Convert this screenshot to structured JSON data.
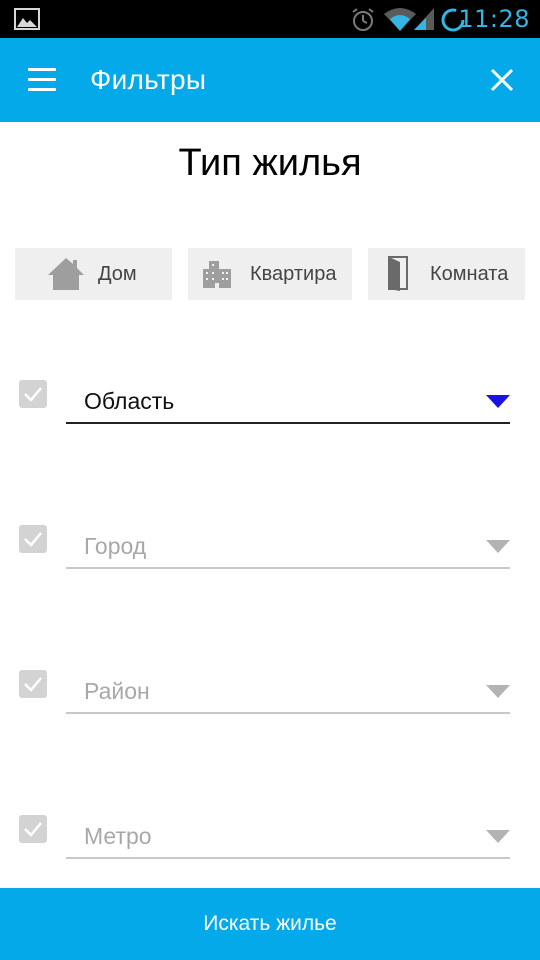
{
  "status_bar": {
    "time": "11:28",
    "icons": [
      "gallery-icon",
      "alarm-icon",
      "wifi-icon",
      "signal-icon",
      "sync-icon"
    ]
  },
  "toolbar": {
    "title": "Фильтры",
    "menu_icon": "hamburger-menu-icon",
    "close_icon": "close-icon",
    "background": "#03a9e8"
  },
  "housing": {
    "title": "Тип жилья",
    "types": [
      {
        "label": "Дом",
        "icon": "house-icon"
      },
      {
        "label": "Квартира",
        "icon": "apartment-building-icon"
      },
      {
        "label": "Комната",
        "icon": "door-icon"
      }
    ]
  },
  "filters": [
    {
      "label": "Область",
      "active": true
    },
    {
      "label": "Город",
      "active": false
    },
    {
      "label": "Район",
      "active": false
    },
    {
      "label": "Метро",
      "active": false
    }
  ],
  "search_button": {
    "label": "Искать жилье"
  },
  "colors": {
    "accent": "#03a9e8",
    "active_arrow": "#1a10e8",
    "inactive_text": "#a8a8a8",
    "checkbox": "#d3d3d3"
  }
}
